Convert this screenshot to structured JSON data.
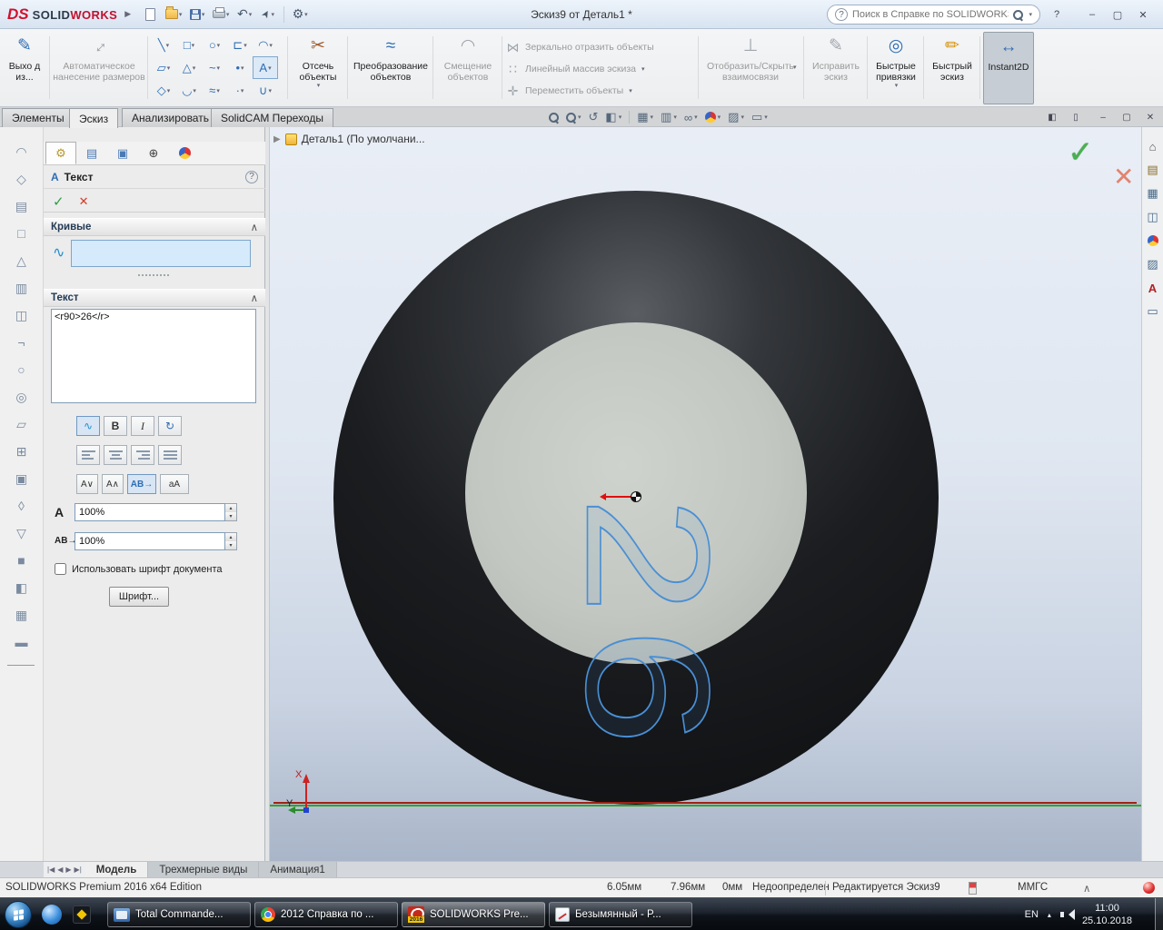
{
  "titlebar": {
    "ds": "DS",
    "solid": "SOLID",
    "works": "WORKS",
    "doc_title": "Эскиз9 от Деталь1 *",
    "search_placeholder": "Поиск в Справке по SOLIDWORKS"
  },
  "ribbon": {
    "exit_sketch": "Выхо д из...",
    "smart_dimension": "Автоматическое нанесение размеров",
    "grid_icons": [
      "╲",
      "□",
      "○",
      "⊏",
      "◠",
      "▱",
      "△",
      "~",
      "•",
      "А",
      "◇",
      "◡",
      "≈",
      "·",
      "∪"
    ],
    "trim": "Отсечь объекты",
    "convert": "Преобразование объектов",
    "offset": "Смещение объектов",
    "mirror": "Зеркально отразить объекты",
    "linear_pattern": "Линейный массив эскиза",
    "move": "Переместить объекты",
    "relations": "Отобразить/Скрыть взаимосвязи",
    "repair": "Исправить эскиз",
    "quick_snaps": "Быстрые привязки",
    "rapid_sketch": "Быстрый эскиз",
    "instant2d": "Instant2D"
  },
  "tabs": {
    "features": "Элементы",
    "sketch": "Эскиз",
    "evaluate": "Анализировать",
    "solidcam": "SolidCAM Переходы"
  },
  "left_toolbar_icons": [
    "◠",
    "◇",
    "▤",
    "□",
    "△",
    "▥",
    "◫",
    "¬",
    "○",
    "◎",
    "▱",
    "⊞",
    "▣",
    "◊",
    "▽",
    "■",
    "◧",
    "▦",
    "▬"
  ],
  "property_panel": {
    "title": "Текст",
    "curves_label": "Кривые",
    "text_label": "Текст",
    "text_value": "<r90>26</r>",
    "bold": "B",
    "italic": "I",
    "flip_v1": "А∨",
    "flip_v2": "А∧",
    "dir_ab": "АВ→",
    "dir_aa": "аА",
    "width_factor": "100%",
    "spacing": "100%",
    "use_doc_font": "Использовать шрифт документа",
    "font_button": "Шрифт..."
  },
  "viewport": {
    "breadcrumb": "Деталь1  (По умолчани...",
    "sketch_text": "26",
    "axis_x": "X",
    "axis_y": "Y"
  },
  "bottom_tabs": {
    "nav": [
      "|◀",
      "◀",
      "▶",
      "▶|"
    ],
    "model": "Модель",
    "views3d": "Трехмерные виды",
    "animation": "Анимация1"
  },
  "statusbar": {
    "edition": "SOLIDWORKS Premium 2016 x64 Edition",
    "coord_x": "6.05мм",
    "coord_y": "7.96мм",
    "coord_z": "0мм",
    "state": "Недоопределен",
    "editing": "Редактируется Эскиз9",
    "units": "ММГС"
  },
  "taskbar": {
    "btn1": "Total Commande...",
    "btn2": "2012 Справка по ...",
    "btn3": "SOLIDWORKS Pre...",
    "btn3_year": "2016",
    "btn4": "Безымянный - P...",
    "lang": "EN",
    "time": "11:00",
    "date": "25.10.2018"
  },
  "icons": {
    "chevron": "▾",
    "up": "▴",
    "expander": "▶",
    "check": "✓",
    "cancel": "✕",
    "help": "?",
    "minimize": "–",
    "maximize": "▢",
    "close": "✕",
    "collapse": "∧",
    "undo": "↶",
    "gear": "⚙",
    "pencil": "✎",
    "pencil2": "✏",
    "scissors": "✂",
    "dim": "↔",
    "convert": "≈",
    "offset": "◠",
    "mirror": "⋈",
    "pattern": "∷",
    "move": "✛",
    "relations": "⊥",
    "snaps": "◎",
    "instant": "↔",
    "curve": "∿",
    "rotate": "↻",
    "prev_view": "↺",
    "section": "◧",
    "display": "▥",
    "orientation": "▦",
    "glasses": "∞",
    "scene": "▨",
    "monitor": "▭",
    "cursor": "➤",
    "home": "⌂",
    "library": "▤",
    "explorer": "▦",
    "palette": "◫",
    "scene_r": "▨",
    "props": "А",
    "screen": "▭",
    "pane": "◧",
    "pane2": "▯",
    "pm_tab1": "⚙",
    "pm_tab2": "▤",
    "pm_tab3": "▣",
    "pm_tab4": "⊕"
  }
}
